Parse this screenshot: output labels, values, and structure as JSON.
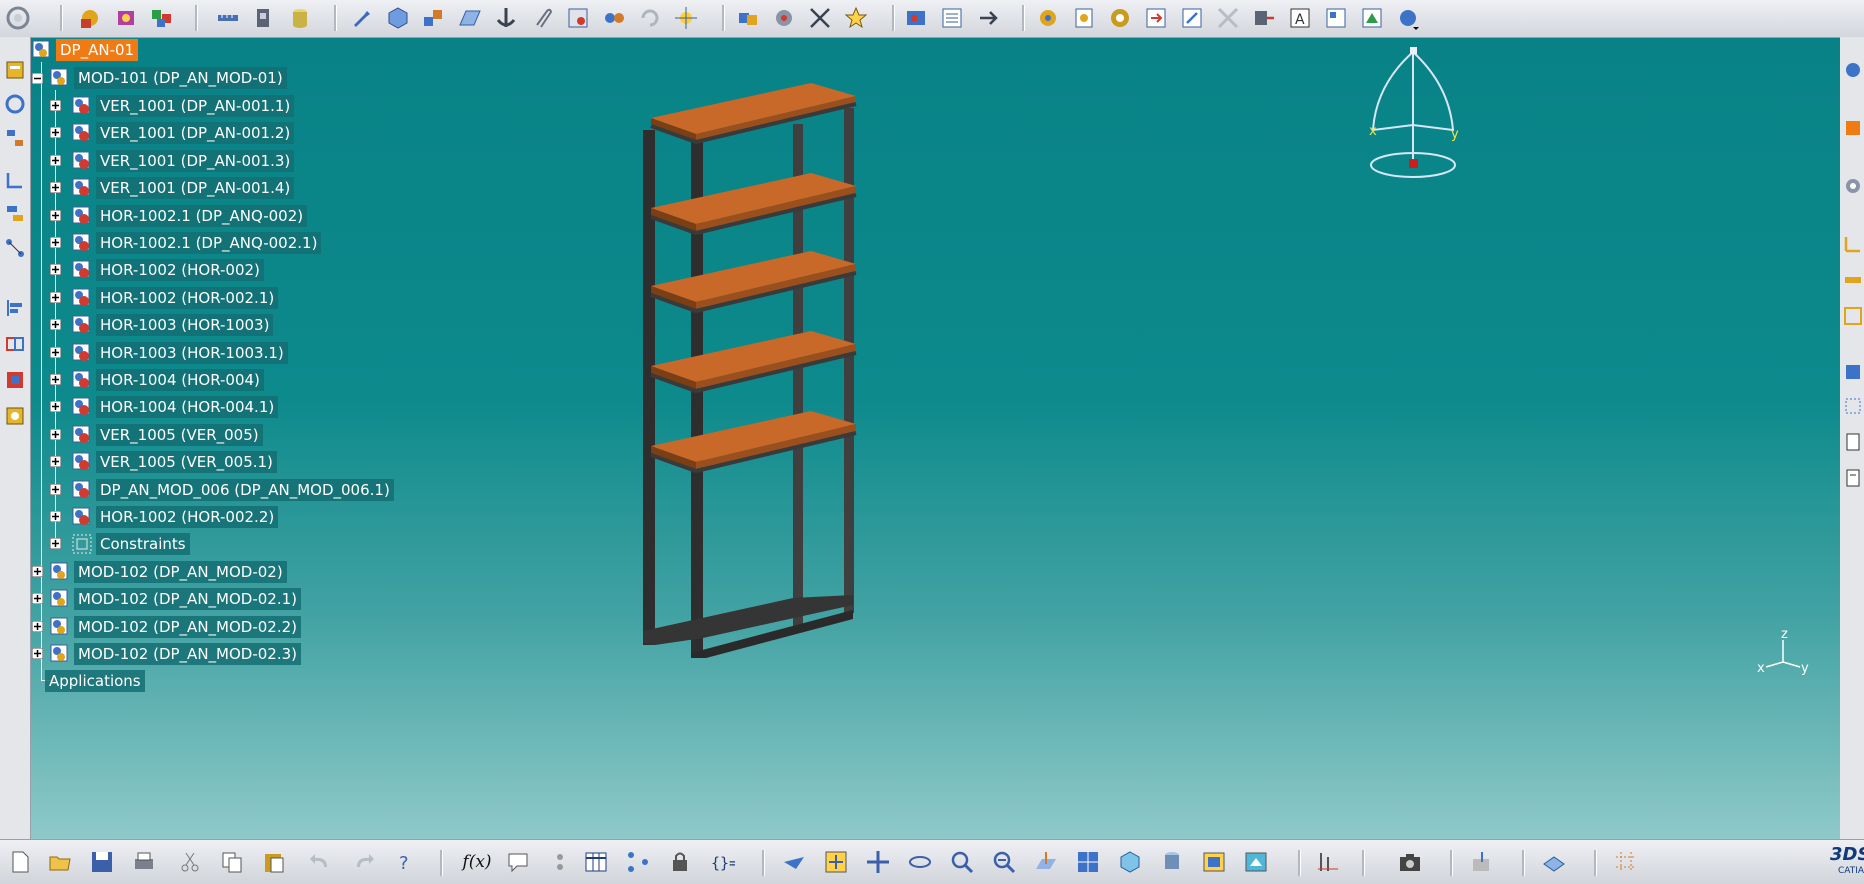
{
  "tree": {
    "root": {
      "label": "DP_AN-01"
    },
    "module": {
      "label": "MOD-101 (DP_AN_MOD-01)"
    },
    "children": [
      {
        "label": "VER_1001 (DP_AN-001.1)"
      },
      {
        "label": "VER_1001 (DP_AN-001.2)"
      },
      {
        "label": "VER_1001 (DP_AN-001.3)"
      },
      {
        "label": "VER_1001 (DP_AN-001.4)"
      },
      {
        "label": "HOR-1002.1 (DP_ANQ-002)"
      },
      {
        "label": "HOR-1002.1 (DP_ANQ-002.1)"
      },
      {
        "label": "HOR-1002 (HOR-002)"
      },
      {
        "label": "HOR-1002 (HOR-002.1)"
      },
      {
        "label": "HOR-1003 (HOR-1003)"
      },
      {
        "label": "HOR-1003 (HOR-1003.1)"
      },
      {
        "label": "HOR-1004 (HOR-004)"
      },
      {
        "label": "HOR-1004 (HOR-004.1)"
      },
      {
        "label": "VER_1005 (VER_005)"
      },
      {
        "label": "VER_1005 (VER_005.1)"
      },
      {
        "label": "DP_AN_MOD_006 (DP_AN_MOD_006.1)"
      },
      {
        "label": "HOR-1002 (HOR-002.2)"
      },
      {
        "label": "Constraints"
      }
    ],
    "siblings": [
      {
        "label": "MOD-102 (DP_AN_MOD-02)"
      },
      {
        "label": "MOD-102 (DP_AN_MOD-02.1)"
      },
      {
        "label": "MOD-102 (DP_AN_MOD-02.2)"
      },
      {
        "label": "MOD-102 (DP_AN_MOD-02.3)"
      }
    ],
    "applications": {
      "label": "Applications"
    }
  },
  "compass": {
    "x_label": "x",
    "y_label": "y"
  },
  "axis_triad": {
    "x_label": "x",
    "y_label": "y",
    "z_label": "z"
  },
  "bottom_toolbar": {
    "formula_label": "f(x)"
  },
  "brand": {
    "logo_text": "3DS",
    "sub_text": "CATIA"
  },
  "colors": {
    "viewport_top": "#088286",
    "viewport_bottom": "#8fc9c9",
    "selection": "#f07b14",
    "shelf_wood": "#c8692a",
    "frame_metal": "#5a5a5a"
  }
}
